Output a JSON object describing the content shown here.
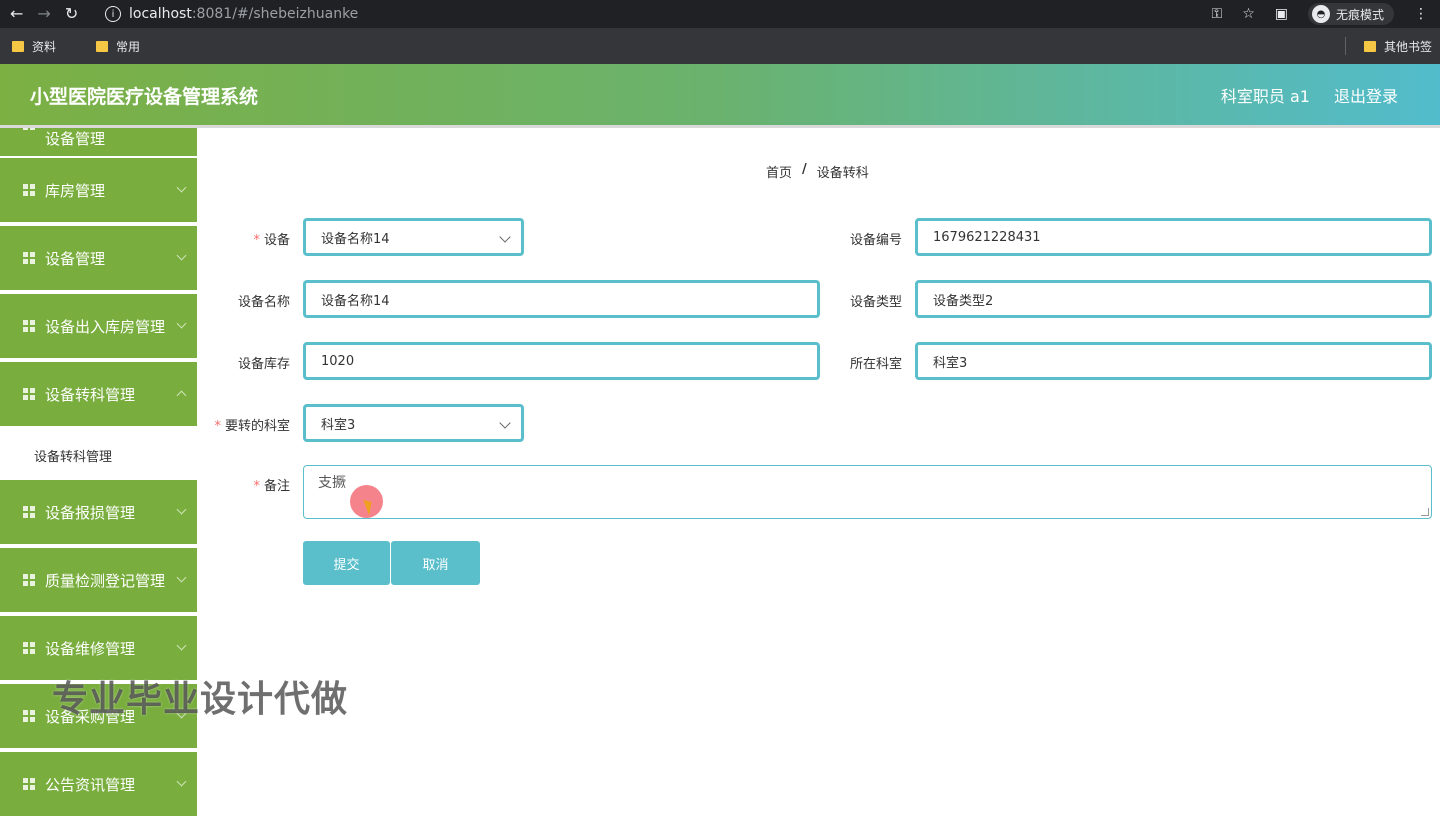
{
  "browser": {
    "url_host": "localhost",
    "url_rest": ":8081/#/shebeizhuanke",
    "incognito_label": "无痕模式",
    "bookmarks": [
      "资料",
      "常用"
    ],
    "other_bookmarks": "其他书签"
  },
  "header": {
    "title": "小型医院医疗设备管理系统",
    "user": "科室职员 a1",
    "logout": "退出登录"
  },
  "sidebar": {
    "partial_label": "设备管理",
    "items": [
      {
        "label": "库房管理"
      },
      {
        "label": "设备管理"
      },
      {
        "label": "设备出入库房管理"
      },
      {
        "label": "设备转科管理"
      },
      {
        "label": "设备报损管理"
      },
      {
        "label": "质量检测登记管理"
      },
      {
        "label": "设备维修管理"
      },
      {
        "label": "设备采购管理"
      },
      {
        "label": "公告资讯管理"
      }
    ],
    "active_sub": "设备转科管理"
  },
  "breadcrumb": {
    "home": "首页",
    "separator": "/",
    "current": "设备转科"
  },
  "form": {
    "device_label": "设备",
    "device_value": "设备名称14",
    "code_label": "设备编号",
    "code_value": "1679621228431",
    "name_label": "设备名称",
    "name_value": "设备名称14",
    "type_label": "设备类型",
    "type_value": "设备类型2",
    "stock_label": "设备库存",
    "stock_value": "1020",
    "dept_label": "所在科室",
    "dept_value": "科室3",
    "target_label": "要转的科室",
    "target_value": "科室3",
    "note_label": "备注",
    "note_value": "支撅",
    "submit": "提交",
    "cancel": "取消"
  },
  "watermark": "专业毕业设计代做",
  "colors": {
    "sidebar": "#79ae3e",
    "accent": "#5abfcb",
    "required": "#f56c6c"
  }
}
